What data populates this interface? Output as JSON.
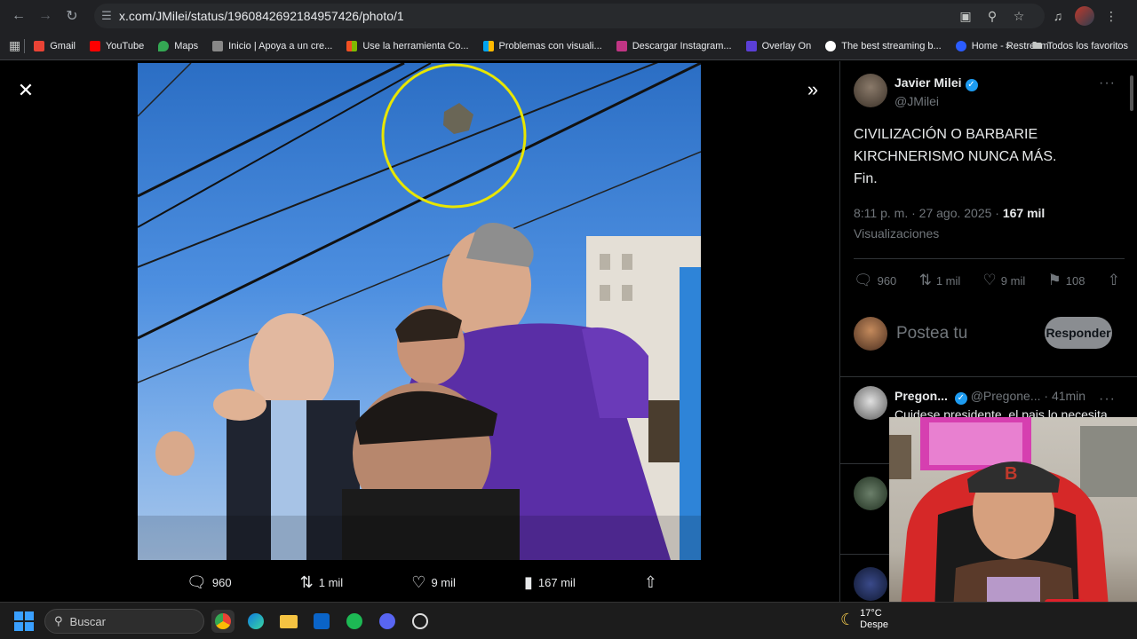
{
  "browser": {
    "url": "x.com/JMilei/status/1960842692184957426/photo/1",
    "bookmarks": [
      {
        "label": "Gmail",
        "color": "#ea4335"
      },
      {
        "label": "YouTube",
        "color": "#ff0000"
      },
      {
        "label": "Maps",
        "color": "#34a853"
      },
      {
        "label": "Inicio | Apoya a un cre...",
        "color": "#888888"
      },
      {
        "label": "Use la herramienta Co...",
        "color": "#f25022"
      },
      {
        "label": "Problemas con visuali...",
        "color": "#7fba00"
      },
      {
        "label": "Descargar Instagram...",
        "color": "#c13584"
      },
      {
        "label": "Overlay On",
        "color": "#5b3fd6"
      },
      {
        "label": "The best streaming b...",
        "color": "#ffffff"
      },
      {
        "label": "Home - Restream",
        "color": "#2b5cff"
      }
    ],
    "all_bookmarks": "Todos los favoritos"
  },
  "viewer": {
    "actions": {
      "replies": "960",
      "reposts": "1 mil",
      "likes": "9 mil",
      "views": "167 mil"
    }
  },
  "tweet": {
    "author_name": "Javier Milei",
    "author_handle": "@JMilei",
    "text_line1": "CIVILIZACIÓN O BARBARIE",
    "text_line2": "KIRCHNERISMO NUNCA MÁS.",
    "text_line3": "Fin.",
    "timestamp": "8:11 p. m. · 27 ago. 2025 · ",
    "views_count": "167 mil",
    "views_label": "Visualizaciones",
    "stats": {
      "replies": "960",
      "reposts": "1 mil",
      "likes": "9 mil",
      "bookmarks": "108"
    },
    "reply_placeholder": "Postea tu",
    "reply_button": "Responder"
  },
  "reply": {
    "name": "Pregon...",
    "handle": "@Pregone... · 41min",
    "text": "Cuidese presidente, el pais lo necesita"
  },
  "taskbar": {
    "search_placeholder": "Buscar",
    "temperature": "17°C",
    "weather": "Despe"
  }
}
